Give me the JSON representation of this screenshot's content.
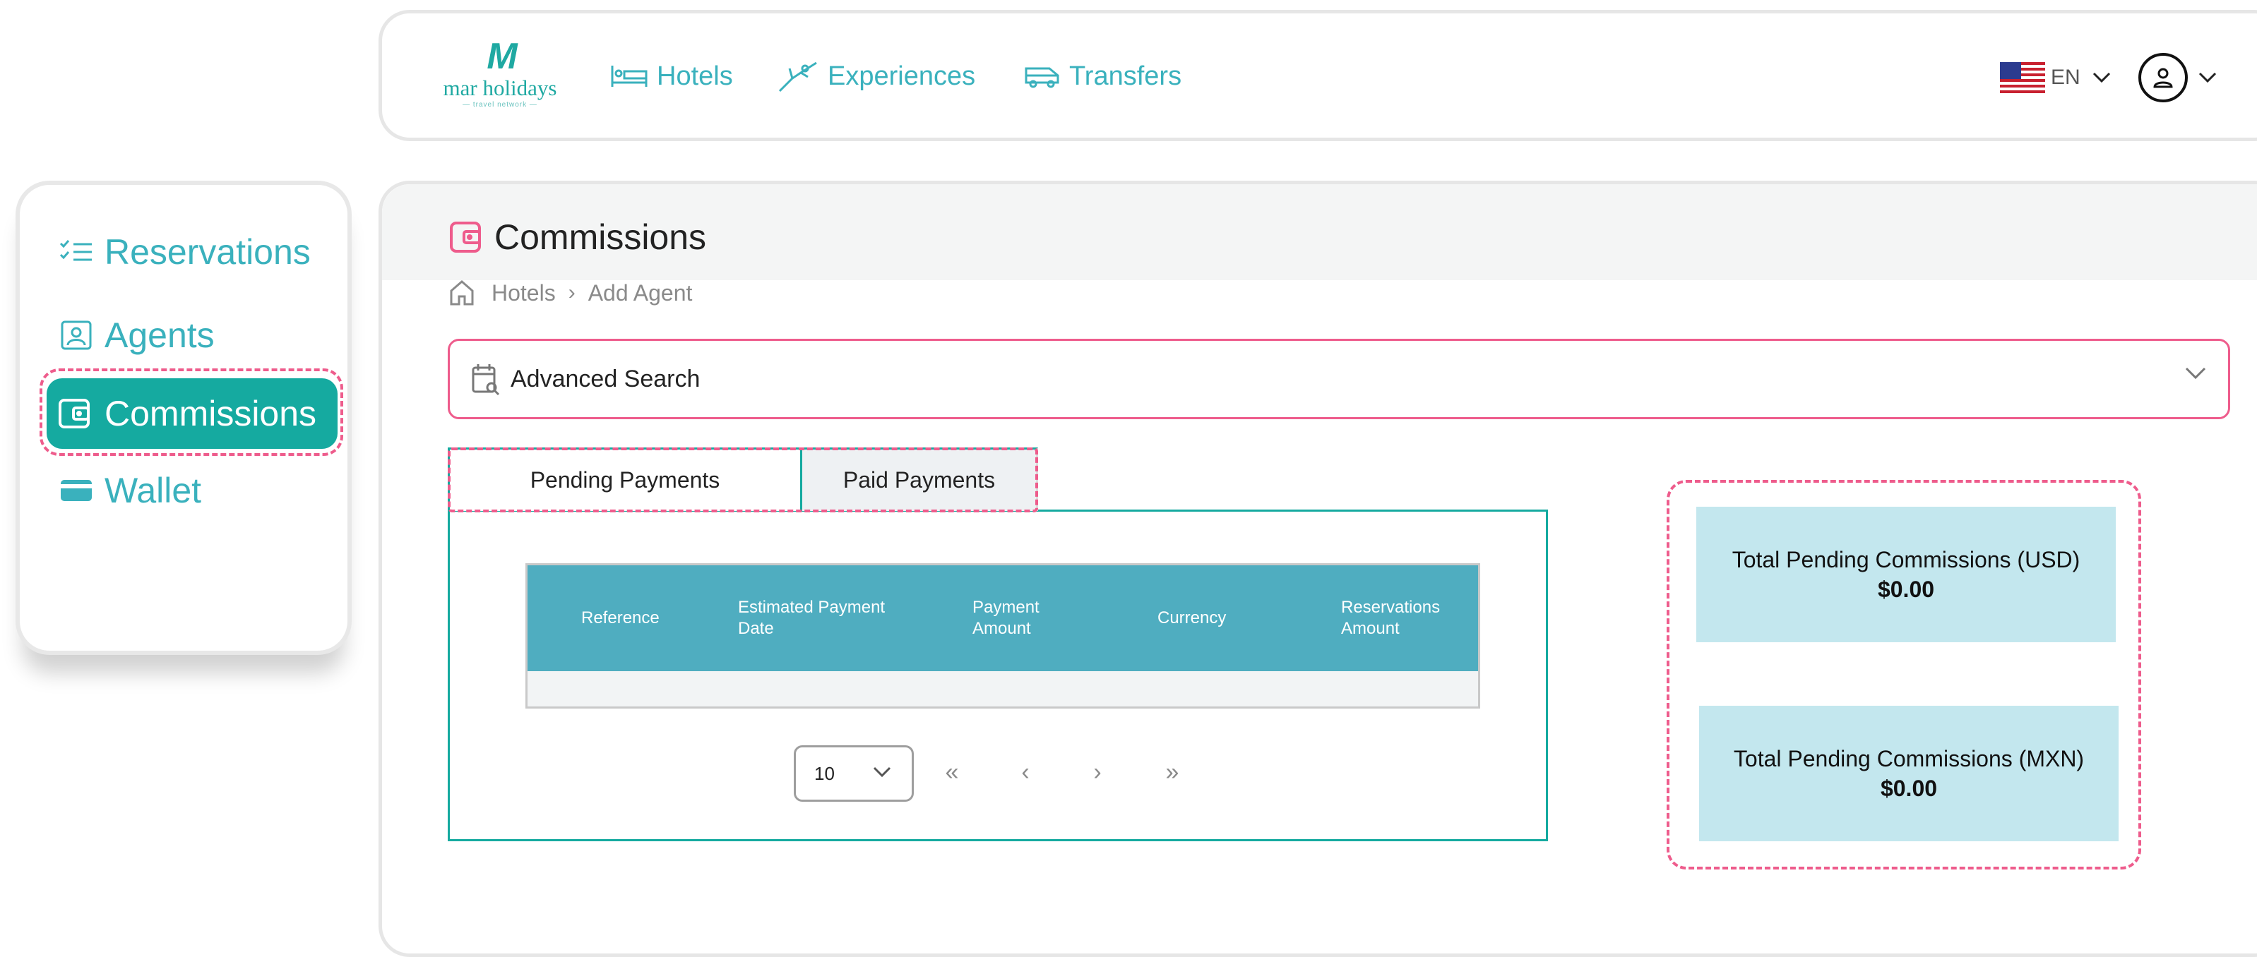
{
  "brand": {
    "mark": "M",
    "name": "mar holidays",
    "tagline": "— travel network —"
  },
  "nav": {
    "hotels": "Hotels",
    "experiences": "Experiences",
    "transfers": "Transfers"
  },
  "language": {
    "code": "EN",
    "flag": "us-flag-icon"
  },
  "sidebar": {
    "items": [
      {
        "label": "Reservations",
        "icon": "checklist-icon"
      },
      {
        "label": "Agents",
        "icon": "agent-id-icon"
      },
      {
        "label": "Commissions",
        "icon": "wallet-icon",
        "active": true
      },
      {
        "label": "Wallet",
        "icon": "card-icon"
      }
    ]
  },
  "page": {
    "title": "Commissions",
    "breadcrumb": [
      "Hotels",
      "Add Agent"
    ]
  },
  "search": {
    "label": "Advanced Search"
  },
  "tabs": {
    "pending": "Pending Payments",
    "paid": "Paid Payments"
  },
  "table": {
    "columns": [
      "Reference",
      "Estimated Payment Date",
      "Payment Amount",
      "Currency",
      "Reservations Amount"
    ],
    "rows": []
  },
  "pagination": {
    "page_size": "10",
    "first": "«",
    "prev": "‹",
    "next": "›",
    "last": "»"
  },
  "totals": {
    "usd": {
      "label": "Total Pending Commissions (USD)",
      "value": "$0.00"
    },
    "mxn": {
      "label": "Total Pending Commissions (MXN)",
      "value": "$0.00"
    }
  },
  "colors": {
    "accent": "#15aaa0",
    "link": "#3ab1bd",
    "highlight": "#ee5c8c",
    "table_header": "#4fadc0",
    "totals_bg": "#c3e7ee"
  }
}
